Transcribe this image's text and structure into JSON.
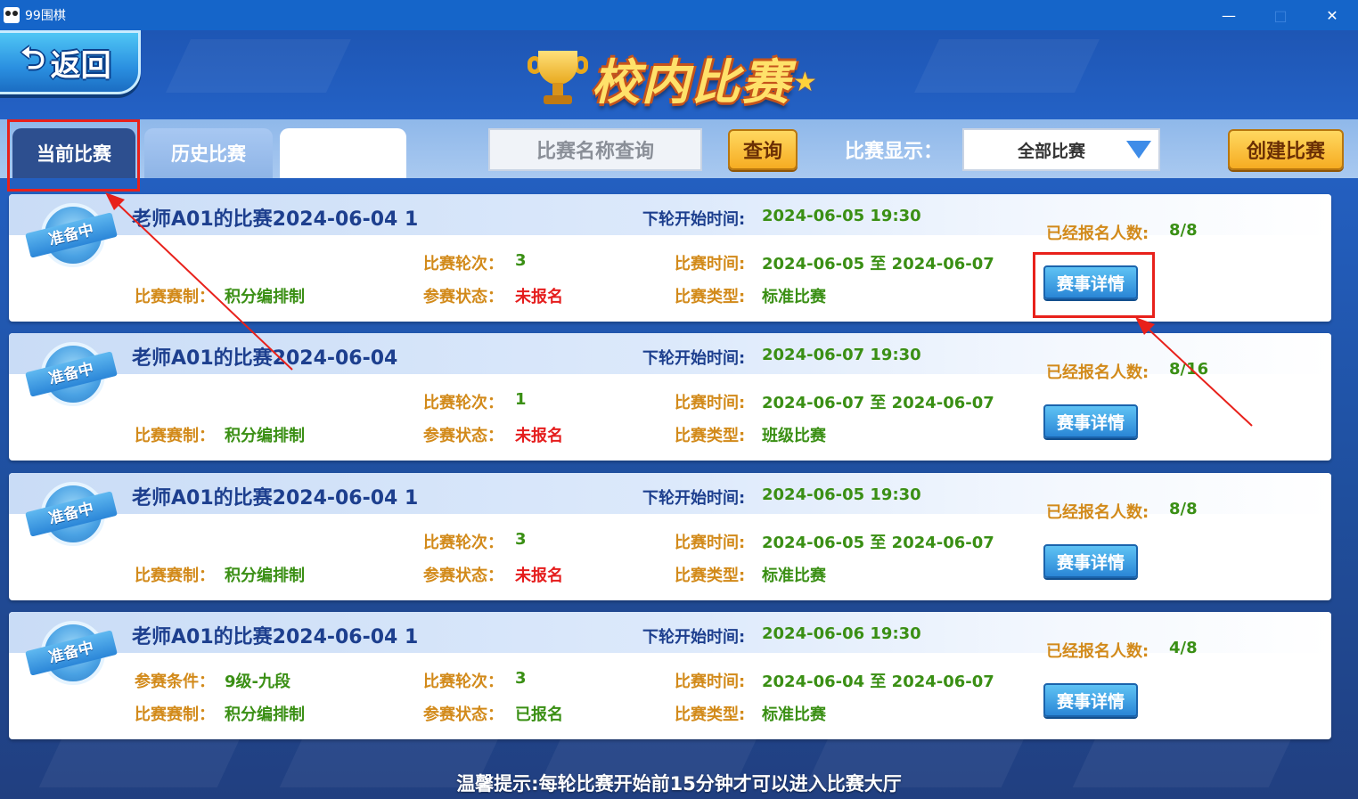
{
  "window": {
    "title": "99围棋",
    "controls": [
      "minimize",
      "maximize",
      "close"
    ]
  },
  "header": {
    "back_label": "返回",
    "title": "校内比赛"
  },
  "toolbar": {
    "tabs": [
      {
        "label": "当前比赛",
        "active": true
      },
      {
        "label": "历史比赛",
        "active": false
      },
      {
        "label": "",
        "active": false
      }
    ],
    "search_placeholder": "比赛名称查询",
    "query_label": "查询",
    "display_label": "比赛显示：",
    "display_value": "全部比赛",
    "create_label": "创建比赛"
  },
  "labels": {
    "next_round": "下轮开始时间:",
    "registered": "已经报名人数:",
    "rounds": "比赛轮次：",
    "time": "比赛时间:",
    "format": "比赛赛制：",
    "status": "参赛状态：",
    "type": "比赛类型:",
    "condition": "参赛条件：",
    "detail_button": "赛事详情",
    "badge": "准备中"
  },
  "matches": [
    {
      "title": "老师A01的比赛2024-06-04 1",
      "next_round": "2024-06-05 19:30",
      "registered": "8/8",
      "rounds": "3",
      "time": "2024-06-05 至 2024-06-07",
      "condition": "",
      "format": "积分编排制",
      "status": "未报名",
      "status_color": "#e51d1d",
      "type": "标准比赛"
    },
    {
      "title": "老师A01的比赛2024-06-04",
      "next_round": "2024-06-07 19:30",
      "registered": "8/16",
      "rounds": "1",
      "time": "2024-06-07 至 2024-06-07",
      "condition": "",
      "format": "积分编排制",
      "status": "未报名",
      "status_color": "#e51d1d",
      "type": "班级比赛"
    },
    {
      "title": "老师A01的比赛2024-06-04 1",
      "next_round": "2024-06-05 19:30",
      "registered": "8/8",
      "rounds": "3",
      "time": "2024-06-05 至 2024-06-07",
      "condition": "",
      "format": "积分编排制",
      "status": "未报名",
      "status_color": "#e51d1d",
      "type": "标准比赛"
    },
    {
      "title": "老师A01的比赛2024-06-04 1",
      "next_round": "2024-06-06 19:30",
      "registered": "4/8",
      "rounds": "3",
      "time": "2024-06-04 至 2024-06-07",
      "condition": "9级-九段",
      "format": "积分编排制",
      "status": "已报名",
      "status_color": "#3a8f14",
      "type": "标准比赛"
    }
  ],
  "tip": "温馨提示:每轮比赛开始前15分钟才可以进入比赛大厅",
  "colors": {
    "titlebar": "#1565c9",
    "accent_gold": "#f6ac22",
    "label_orange": "#d28a1a",
    "value_green": "#3a8f14",
    "status_red": "#e51d1d",
    "annotation_red": "#e8211b"
  }
}
